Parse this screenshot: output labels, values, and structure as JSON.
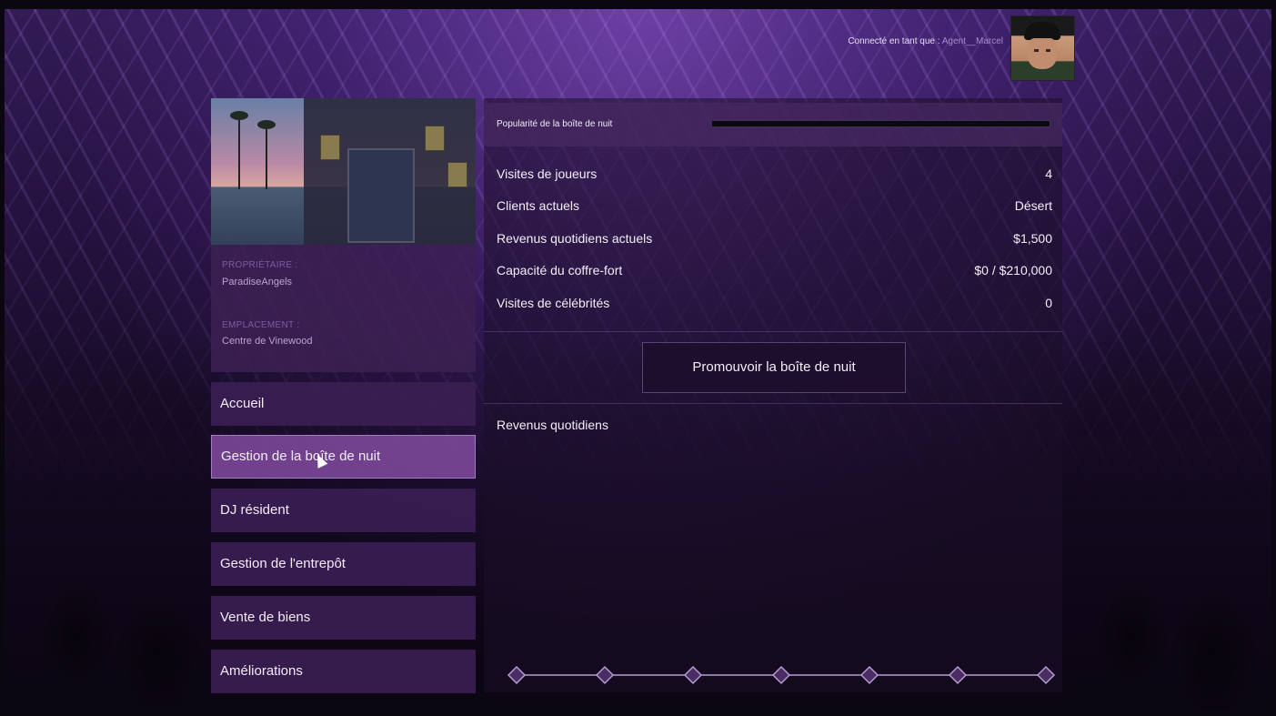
{
  "header": {
    "logged_in_label": "Connecté en tant que :",
    "username": "Agent__Marcel"
  },
  "property": {
    "owner_label": "PROPRIÉTAIRE :",
    "owner_value": "ParadiseAngels",
    "location_label": "EMPLACEMENT :",
    "location_value": "Centre de Vinewood"
  },
  "menu": {
    "items": [
      {
        "label": "Accueil"
      },
      {
        "label": "Gestion de la boîte de nuit"
      },
      {
        "label": "DJ résident"
      },
      {
        "label": "Gestion de l'entrepôt"
      },
      {
        "label": "Vente de biens"
      },
      {
        "label": "Améliorations"
      }
    ],
    "active_index": 1
  },
  "popularity": {
    "label": "Popularité de la boîte de nuit",
    "level": 0.0
  },
  "stats": [
    {
      "label": "Visites de joueurs",
      "value": "4"
    },
    {
      "label": "Clients actuels",
      "value": "Désert"
    },
    {
      "label": "Revenus quotidiens actuels",
      "value": "$1,500"
    },
    {
      "label": "Capacité du coffre-fort",
      "value": "$0 / $210,000"
    },
    {
      "label": "Visites de célébrités",
      "value": "0"
    }
  ],
  "promote_button": "Promouvoir la boîte de nuit",
  "revenue_title": "Revenus quotidiens",
  "chart_data": {
    "type": "line",
    "title": "Revenus quotidiens",
    "values": [
      0,
      0,
      0,
      0,
      0,
      0,
      0
    ],
    "marker": "diamond"
  },
  "colors": {
    "accent": "#a27cc2",
    "panel": "#3a1e52",
    "marker": "#b79ad2"
  }
}
